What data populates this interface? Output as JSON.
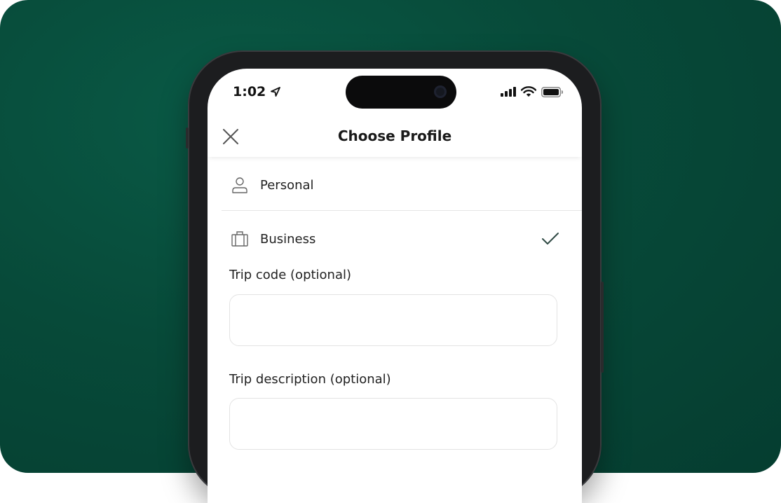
{
  "status_bar": {
    "time": "1:02"
  },
  "header": {
    "title": "Choose Profile",
    "close_icon": "close-icon"
  },
  "profiles": [
    {
      "label": "Personal",
      "icon": "person-icon",
      "selected": false
    },
    {
      "label": "Business",
      "icon": "briefcase-icon",
      "selected": true
    }
  ],
  "fields": {
    "trip_code": {
      "label": "Trip code (optional)",
      "value": "",
      "placeholder": ""
    },
    "trip_description": {
      "label": "Trip description (optional)",
      "value": "",
      "placeholder": ""
    }
  },
  "colors": {
    "background": "#064a3a",
    "check": "#2f4a44"
  }
}
